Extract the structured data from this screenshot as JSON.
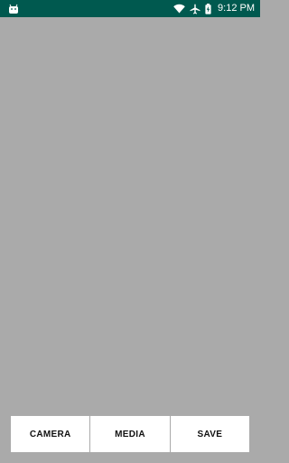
{
  "status_bar": {
    "time": "9:12 PM",
    "icons": [
      "android-icon",
      "wifi-icon",
      "airplane-mode-icon",
      "battery-charging-icon"
    ],
    "background": "#00594f"
  },
  "preview": {
    "background": "#aaaaaa"
  },
  "buttons": {
    "camera_label": "CAMERA",
    "media_label": "MEDIA",
    "save_label": "SAVE"
  }
}
